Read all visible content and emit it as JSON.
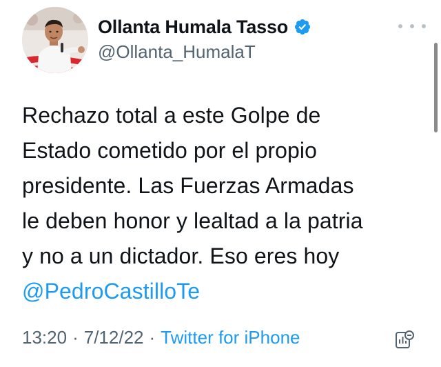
{
  "author": {
    "display_name": "Ollanta Humala Tasso",
    "handle": "@Ollanta_HumalaT",
    "verified": true,
    "avatar_icon": "profile-photo"
  },
  "tweet": {
    "lines": [
      "Rechazo total a este Golpe de",
      "Estado cometido por el propio",
      "presidente. Las Fuerzas Armadas",
      "le deben honor y lealtad a la patria",
      "y no a un dictador. Eso eres hoy"
    ],
    "mention": "@PedroCastilloTe"
  },
  "meta": {
    "time": "13:20",
    "separator": "·",
    "date": "7/12/22",
    "source": "Twitter for iPhone"
  },
  "colors": {
    "text": "#0f1419",
    "secondary": "#536471",
    "link": "#1d9bf0",
    "verified": "#1d9bf0"
  },
  "icons": {
    "more": "more-dots-icon",
    "verified": "verified-badge-icon",
    "analytics": "view-analytics-icon"
  }
}
